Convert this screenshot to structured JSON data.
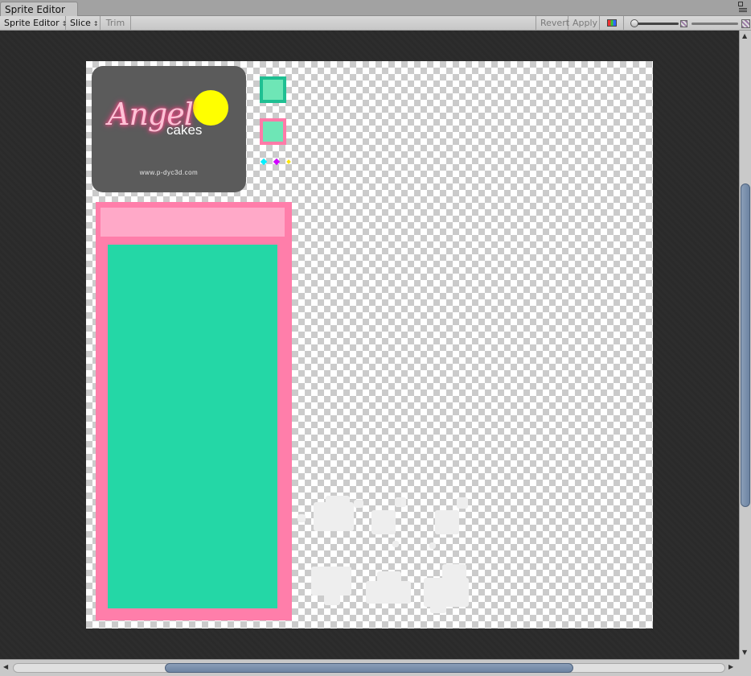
{
  "window": {
    "tab_title": "Sprite Editor"
  },
  "toolbar": {
    "sprite_editor_label": "Sprite Editor",
    "slice_label": "Slice",
    "trim_label": "Trim",
    "revert_label": "Revert",
    "apply_label": "Apply",
    "dropdown_arrow": "↕"
  },
  "icons": {
    "window_menu": "menu-icon",
    "maximize": "maximize-icon",
    "color_channels": "rgb-channel-icon",
    "mip_small": "checker-small-icon",
    "mip_large": "checker-large-icon"
  },
  "sprite_sheet": {
    "logo": {
      "script_text": "Angel",
      "word": "cakes",
      "url": "www.p-dyc3d.com",
      "background_color": "#5b5b5b",
      "sun_color": "#ffff00"
    },
    "swatches": [
      {
        "name": "green-swatch",
        "fill": "#6ee6b6",
        "border": "#1fbf92"
      },
      {
        "name": "pink-swatch",
        "fill": "#6ee6b6",
        "border": "#ff7aa8"
      }
    ],
    "dots": [
      "#00f0ff",
      "#d000ff",
      "#ffe600"
    ],
    "panel": {
      "outer_color": "#ff7eaa",
      "header_color": "#ffa9c8",
      "body_color": "#24d7a6"
    },
    "cloud_color": "#eeeeee"
  },
  "colors": {
    "viewport_bg": "#2b2b2b",
    "checker_light": "#ffffff",
    "checker_dark": "#cbcbcb",
    "scroll_thumb": "#7a90ad"
  }
}
